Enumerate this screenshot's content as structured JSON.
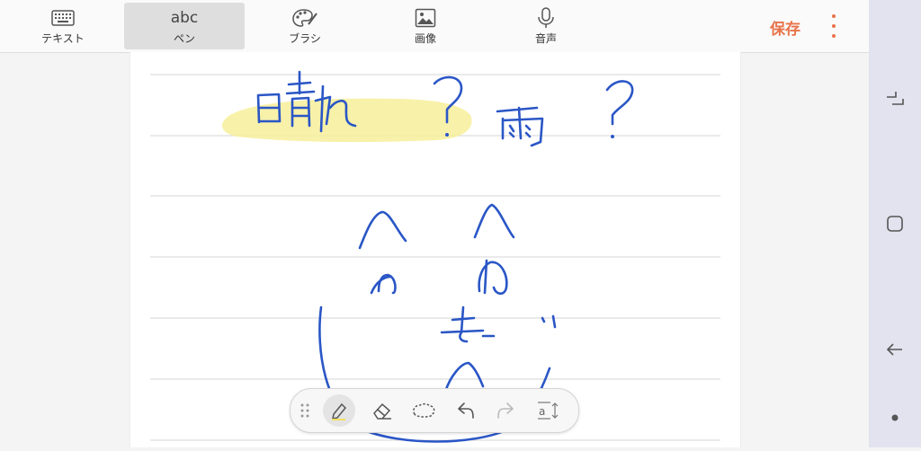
{
  "topbar": {
    "tabs": [
      {
        "label": "テキスト",
        "icon": "keyboard-icon"
      },
      {
        "label": "ペン",
        "icon_text": "abc",
        "active": true
      },
      {
        "label": "ブラシ",
        "icon": "palette-icon"
      },
      {
        "label": "画像",
        "icon": "image-icon"
      },
      {
        "label": "音声",
        "icon": "microphone-icon"
      }
    ],
    "save_label": "保存",
    "more_icon": "more-vert-icon"
  },
  "toolbar": {
    "tools": [
      "drag-handle-icon",
      "pen-icon",
      "eraser-icon",
      "lasso-icon",
      "undo-icon",
      "redo-icon",
      "text-convert-icon"
    ],
    "active_tool": "pen-icon"
  },
  "navigation": [
    "recent-apps-icon",
    "home-icon",
    "back-icon",
    "dot-indicator-icon"
  ],
  "colors": {
    "accent": "#e8734a",
    "ink": "#2a56c6",
    "highlighter": "#f7ef9a",
    "rule_lines": "#d6d6d6"
  }
}
